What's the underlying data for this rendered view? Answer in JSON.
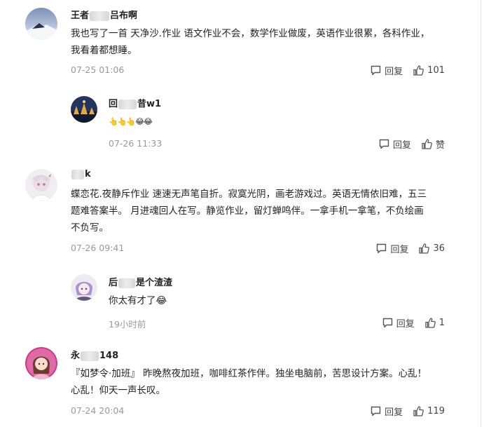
{
  "comments": [
    {
      "name_prefix": "王者",
      "name_suffix": "吕布啊",
      "text_line1": "我也写了一首 天净沙.作业 语文作业不会，数学作业做废，英语作业很累，各科作业，",
      "text_line2": "我看着都想睡。",
      "time": "07-25 01:06",
      "reply_label": "回复",
      "like_count": "101",
      "reply": {
        "name_prefix": "回",
        "name_suffix": "昔w1",
        "text_hands": "👆👆👆",
        "text_faces": "😂😂",
        "time": "07-26 11:33",
        "reply_label": "回复",
        "like_label": "赞"
      }
    },
    {
      "name_prefix": "",
      "name_suffix": "k",
      "text_line1": "蝶恋花.夜静斥作业 速速无声笔自折。寂寞光阴，画老游戏过。英语无情依旧难，五三",
      "text_line2": "题难答案半。 月进魂回人在写。静览作业，留灯蝉鸣伴。一拿手机一拿笔，不负绘画",
      "text_line3": "不负写。",
      "time": "07-26 09:41",
      "reply_label": "回复",
      "like_count": "36",
      "reply": {
        "name_prefix": "后",
        "name_suffix": "是个渣渣",
        "text": "你太有才了😂",
        "time": "19小时前",
        "reply_label": "回复",
        "like_count": "1"
      }
    },
    {
      "name_prefix": "永",
      "name_suffix": "148",
      "text_line1": "『如梦令·加班』 昨晚熬夜加班，咖啡红茶作伴。独坐电脑前，苦思设计方案。心乱！",
      "text_line2": "心乱！仰天一声长叹。",
      "time": "07-24 20:04",
      "reply_label": "回复",
      "like_count": "119"
    }
  ],
  "icons": {
    "reply": "comment-bubble-icon",
    "like": "thumbs-up-icon"
  }
}
